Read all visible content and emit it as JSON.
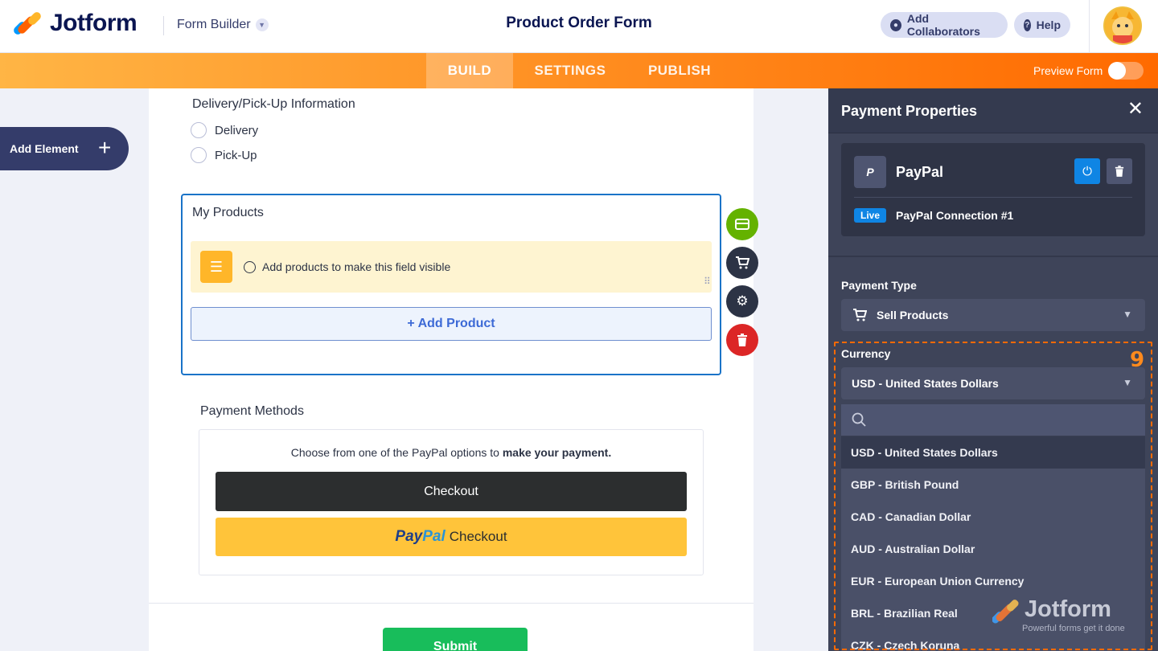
{
  "header": {
    "brand": "Jotform",
    "builder_label": "Form Builder",
    "form_title": "Product Order Form",
    "collaborators_label": "Add Collaborators",
    "help_label": "Help"
  },
  "nav": {
    "tabs": [
      {
        "label": "BUILD",
        "active": true
      },
      {
        "label": "SETTINGS",
        "active": false
      },
      {
        "label": "PUBLISH",
        "active": false
      }
    ],
    "preview_label": "Preview Form"
  },
  "add_element_label": "Add Element",
  "form": {
    "delivery": {
      "question": "Delivery/Pick-Up Information",
      "options": [
        "Delivery",
        "Pick-Up"
      ]
    },
    "products": {
      "question": "My Products",
      "notice": "Add products to make this field visible",
      "add_button": "+ Add Product"
    },
    "payment_methods": {
      "label": "Payment Methods",
      "note_prefix": "Choose from one of the PayPal options to ",
      "note_bold": "make your payment.",
      "checkout_label": "Checkout",
      "paypal_word_a": "Pay",
      "paypal_word_b": "Pal",
      "paypal_checkout_label": "Checkout"
    },
    "submit_label": "Submit"
  },
  "panel": {
    "title": "Payment Properties",
    "gateway": {
      "name": "PayPal",
      "status_badge": "Live",
      "connection": "PayPal Connection #1"
    },
    "payment_type_label": "Payment Type",
    "payment_type_value": "Sell Products",
    "currency_label": "Currency",
    "currency_value": "USD - United States Dollars",
    "currency_options": [
      "USD - United States Dollars",
      "GBP - British Pound",
      "CAD - Canadian Dollar",
      "AUD - Australian Dollar",
      "EUR - European Union Currency",
      "BRL - Brazilian Real",
      "CZK - Czech Koruna"
    ],
    "step_number": "9"
  },
  "watermark": {
    "brand": "Jotform",
    "tagline": "Powerful forms get it done"
  },
  "colors": {
    "accent_orange": "#ff6a00",
    "panel_bg": "#3e4459",
    "link_blue": "#0f85e4",
    "submit_green": "#18bd5b"
  }
}
